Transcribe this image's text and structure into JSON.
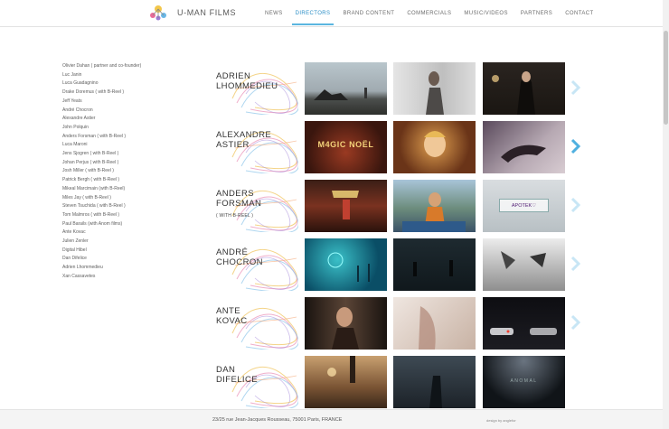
{
  "brand": {
    "name": "U-MAN FILMS",
    "logo_label": "U-MAN"
  },
  "nav": {
    "items": [
      {
        "label": "NEWS"
      },
      {
        "label": "DIRECTORS"
      },
      {
        "label": "BRAND CONTENT"
      },
      {
        "label": "COMMERCIALS"
      },
      {
        "label": "MUSIC/VIDEOS"
      },
      {
        "label": "PARTNERS"
      },
      {
        "label": "CONTACT"
      }
    ],
    "active": "DIRECTORS"
  },
  "directors_list": [
    "Olivier Dahan ( partner and co-founder)",
    "Luc Janin",
    "Luca Guadagnino",
    "Drake Doremus ( with B-Reel )",
    "Jeff Yeats",
    "André Chocron",
    "Alexandre Astier",
    "John Polquin",
    "Anders Forsman ( with B-Reel )",
    "Luca Maroni",
    "Jens Sjogren ( with B-Reel )",
    "Johan Perjus ( with B-Reel )",
    "Josh Miller ( with B-Reel )",
    "Patrick Bergh ( with B-Reel )",
    "Mikeal Marcimain (with B-Reel)",
    "Miles Jay ( with B-Reel )",
    "Steven Tsuchida ( with B-Reel )",
    "Tom Malmros ( with B-Reel )",
    "Paul Barails (with Anom films)",
    "Ante Kovac",
    "Julien Zenler",
    "Digital Hibel",
    "Dan Difelice",
    "Adrien Lhommedieu",
    "Xan Cassavetes"
  ],
  "featured": [
    {
      "line1": "ADRIEN",
      "line2": "LHOMMEDIEU",
      "note": "",
      "thumbs": [
        {
          "caption": ""
        },
        {
          "caption": ""
        },
        {
          "caption": ""
        }
      ]
    },
    {
      "line1": "ALEXANDRE",
      "line2": "ASTIER",
      "note": "",
      "thumbs": [
        {
          "caption": "M4GIC NOËL"
        },
        {
          "caption": ""
        },
        {
          "caption": ""
        }
      ]
    },
    {
      "line1": "ANDERS",
      "line2": "FORSMAN",
      "note": "( WITH B-REEL )",
      "thumbs": [
        {
          "caption": ""
        },
        {
          "caption": ""
        },
        {
          "caption": "APOTEK♡"
        }
      ]
    },
    {
      "line1": "ANDRÉ",
      "line2": "CHOCRON",
      "note": "",
      "thumbs": [
        {
          "caption": ""
        },
        {
          "caption": ""
        },
        {
          "caption": ""
        }
      ]
    },
    {
      "line1": "ANTE",
      "line2": "KOVAC",
      "note": "",
      "thumbs": [
        {
          "caption": ""
        },
        {
          "caption": ""
        },
        {
          "caption": ""
        }
      ]
    },
    {
      "line1": "DAN",
      "line2": "DIFELICE",
      "note": "",
      "thumbs": [
        {
          "caption": ""
        },
        {
          "caption": ""
        },
        {
          "caption": "ANOMAL"
        }
      ]
    }
  ],
  "footer": {
    "address": "23/25 rue Jean-Jacques Rousseau, 75001 Paris, FRANCE",
    "credit": "design by anglefor"
  },
  "colors": {
    "accent": "#2d8fc7",
    "arrow": "#5bb6e0"
  }
}
